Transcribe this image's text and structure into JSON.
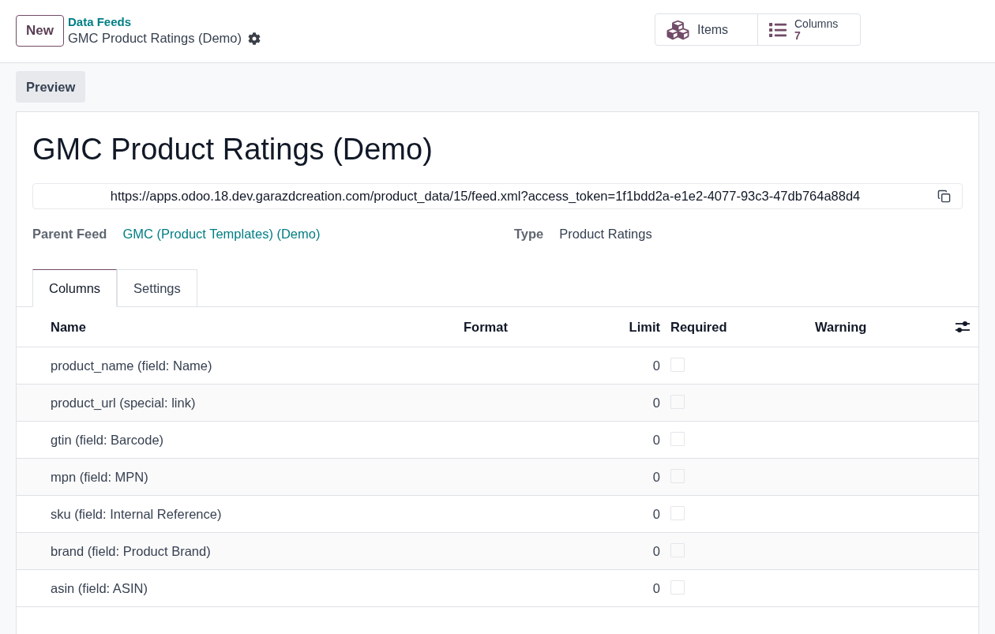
{
  "control_panel": {
    "new_button": "New",
    "breadcrumb": {
      "parent": "Data Feeds",
      "current": "GMC Product Ratings (Demo)"
    },
    "stat_buttons": [
      {
        "kind": "items",
        "label": "Items"
      },
      {
        "kind": "columns",
        "label": "Columns",
        "value": "7"
      }
    ]
  },
  "actions": {
    "preview_button": "Preview"
  },
  "form": {
    "title": "GMC Product Ratings (Demo)",
    "feed_url": "https://apps.odoo.18.dev.garazdcreation.com/product_data/15/feed.xml?access_token=1f1bdd2a-e1e2-4077-93c3-47db764a88d4",
    "fields": [
      {
        "kind": "link",
        "label": "Parent Feed",
        "value": "GMC (Product Templates) (Demo)"
      },
      {
        "kind": "text",
        "label": "Type",
        "value": "Product Ratings"
      }
    ],
    "tabs": [
      {
        "label": "Columns",
        "selected": true
      },
      {
        "label": "Settings",
        "selected": false
      }
    ],
    "table": {
      "columns": [
        "Name",
        "Format",
        "Limit",
        "Required",
        "Warning"
      ],
      "rows": [
        {
          "name": "product_name (field: Name)",
          "limit": "0",
          "required": false
        },
        {
          "name": "product_url (special: link)",
          "limit": "0",
          "required": false
        },
        {
          "name": "gtin (field: Barcode)",
          "limit": "0",
          "required": false
        },
        {
          "name": "mpn (field: MPN)",
          "limit": "0",
          "required": false
        },
        {
          "name": "sku (field: Internal Reference)",
          "limit": "0",
          "required": false
        },
        {
          "name": "brand (field: Product Brand)",
          "limit": "0",
          "required": false
        },
        {
          "name": "asin (field: ASIN)",
          "limit": "0",
          "required": false
        }
      ]
    }
  }
}
